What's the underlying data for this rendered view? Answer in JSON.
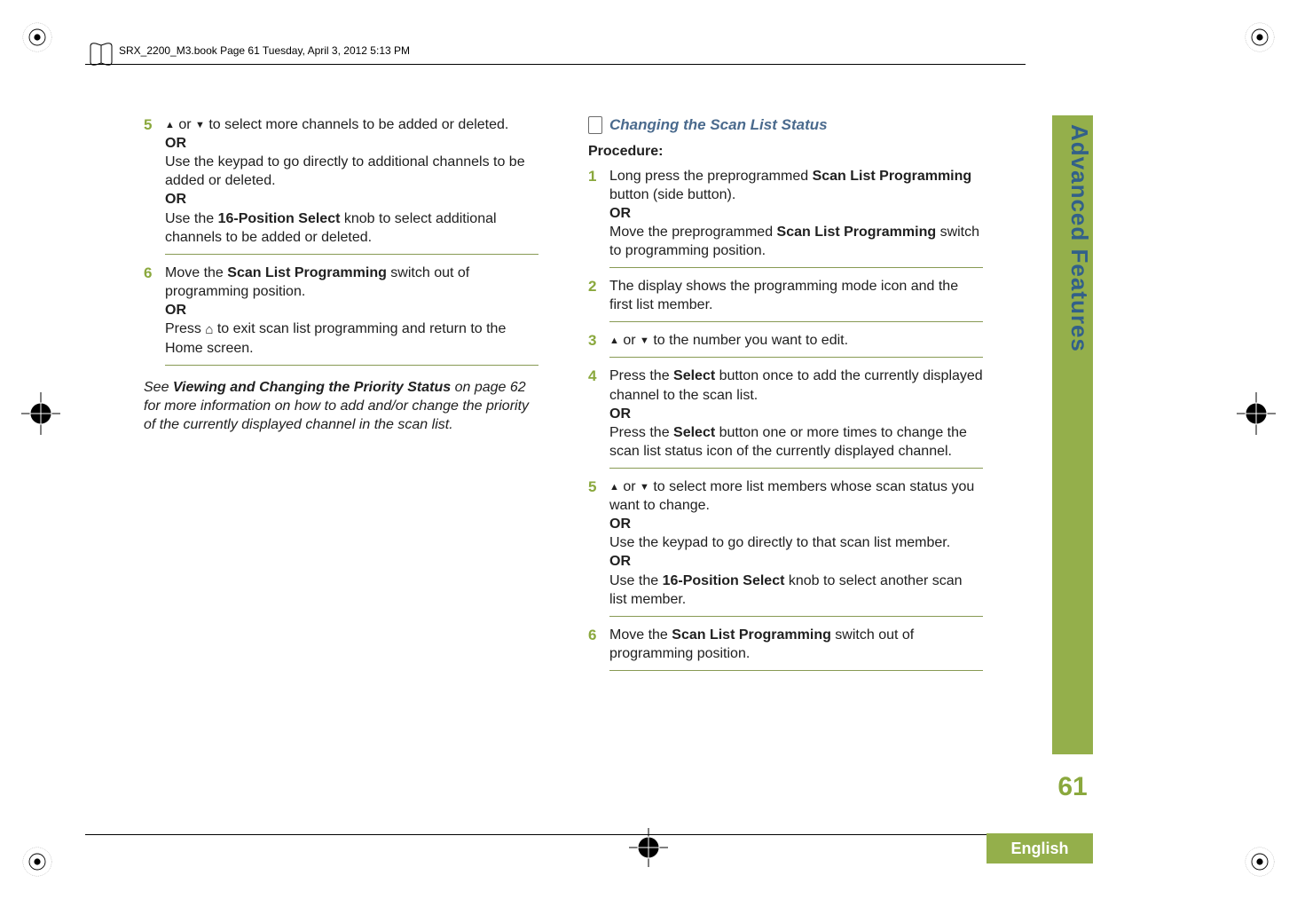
{
  "header": "SRX_2200_M3.book  Page 61  Tuesday, April 3, 2012  5:13 PM",
  "left": {
    "steps": [
      {
        "n": "5",
        "lines": [
          {
            "pre_up_down": true,
            "text": " to select more channels to be added or deleted."
          },
          {
            "bold": "OR"
          },
          {
            "text": "Use the keypad to go directly to additional channels to be added or deleted."
          },
          {
            "bold": "OR"
          },
          {
            "text_pre": "Use the ",
            "bold": "16-Position Select",
            "text_post": " knob to select additional channels to be added or deleted."
          }
        ]
      },
      {
        "n": "6",
        "lines": [
          {
            "text_pre": "Move the ",
            "bold": "Scan List Programming",
            "text_post": " switch out of programming position."
          },
          {
            "bold": "OR"
          },
          {
            "home": true,
            "text_pre": "Press ",
            "text_post": " to exit scan list programming and return to the Home screen."
          }
        ]
      }
    ],
    "note_pre": "See ",
    "note_bold": "Viewing and Changing the Priority Status",
    "note_post": " on page 62 for more information on how to add and/or change the priority of the currently displayed channel in the scan list."
  },
  "right": {
    "subhead": "Changing the Scan List Status",
    "procedure_label": "Procedure:",
    "steps": [
      {
        "n": "1",
        "lines": [
          {
            "text_pre": "Long press the preprogrammed ",
            "bold": "Scan List Programming",
            "text_post": " button (side button)."
          },
          {
            "bold": "OR"
          },
          {
            "text_pre": "Move the preprogrammed ",
            "bold": "Scan List Programming",
            "text_post": " switch to programming position."
          }
        ]
      },
      {
        "n": "2",
        "lines": [
          {
            "text": "The display shows the programming mode icon and the first list member."
          }
        ]
      },
      {
        "n": "3",
        "lines": [
          {
            "pre_up_down": true,
            "text": " to the number you want to edit."
          }
        ]
      },
      {
        "n": "4",
        "lines": [
          {
            "text_pre": "Press the ",
            "bold": "Select",
            "text_post": " button once to add the currently displayed channel to the scan list."
          },
          {
            "bold": "OR"
          },
          {
            "text_pre": "Press the ",
            "bold": "Select",
            "text_post": " button one or more times to change the scan list status icon of the currently displayed channel."
          }
        ]
      },
      {
        "n": "5",
        "lines": [
          {
            "pre_up_down": true,
            "text": " to select more list members whose scan status you want to change."
          },
          {
            "bold": "OR"
          },
          {
            "text": "Use the keypad to go directly to that scan list member."
          },
          {
            "bold": "OR"
          },
          {
            "text_pre": "Use the ",
            "bold": "16-Position Select",
            "text_post": " knob to select another scan list member."
          }
        ]
      },
      {
        "n": "6",
        "lines": [
          {
            "text_pre": "Move the ",
            "bold": "Scan List Programming",
            "text_post": " switch out of programming position."
          }
        ]
      }
    ]
  },
  "side_tab": "Advanced Features",
  "page_number": "61",
  "footer": "English"
}
